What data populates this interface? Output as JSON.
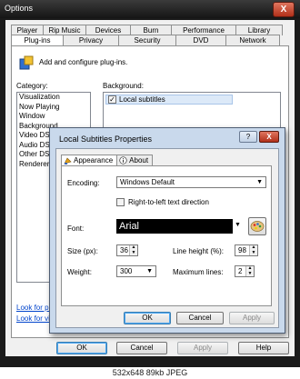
{
  "window": {
    "title": "Options",
    "close_label": "X"
  },
  "tabs_row1": [
    "Player",
    "Rip Music",
    "Devices",
    "Burn",
    "Performance",
    "Library"
  ],
  "tabs_row2": [
    "Plug-ins",
    "Privacy",
    "Security",
    "DVD",
    "Network"
  ],
  "plugins": {
    "header": "Add and configure plug-ins.",
    "category_label": "Category:",
    "categories": [
      "Visualization",
      "Now Playing",
      "Window",
      "Background",
      "Video DSP",
      "Audio DSP",
      "Other DSP",
      "Renderer"
    ],
    "background_label": "Background:",
    "background_items": [
      {
        "label": "Local subtitles",
        "checked": true
      }
    ],
    "link1": "Look for pl",
    "link2": "Look for vi"
  },
  "main_buttons": {
    "ok": "OK",
    "cancel": "Cancel",
    "apply": "Apply",
    "help": "Help"
  },
  "dialog": {
    "title": "Local Subtitles Properties",
    "help_label": "?",
    "close_label": "X",
    "tabs": [
      "Appearance",
      "About"
    ],
    "encoding_label": "Encoding:",
    "encoding_value": "Windows Default",
    "rtl_label": "Right-to-left text direction",
    "rtl_checked": false,
    "font_label": "Font:",
    "font_value": "Arial",
    "size_label": "Size (px):",
    "size_value": "36",
    "line_height_label": "Line height (%):",
    "line_height_value": "98",
    "weight_label": "Weight:",
    "weight_value": "300",
    "max_lines_label": "Maximum lines:",
    "max_lines_value": "2",
    "ok": "OK",
    "cancel": "Cancel",
    "apply": "Apply"
  },
  "caption": "532x648 89kb JPEG"
}
